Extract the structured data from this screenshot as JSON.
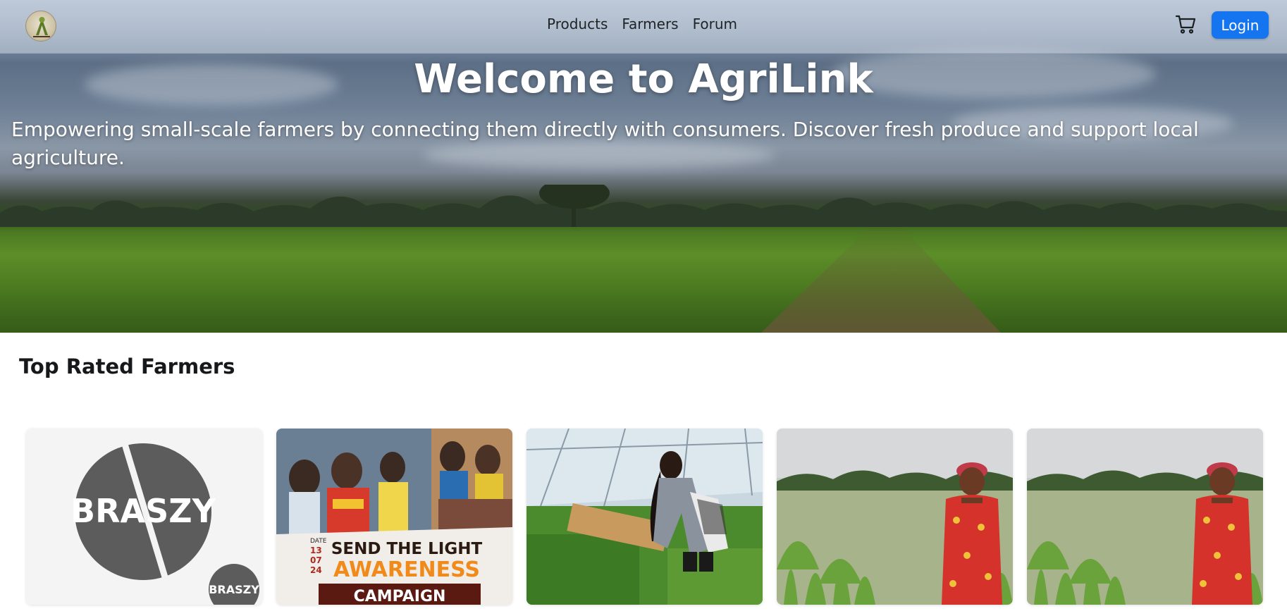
{
  "brand": {
    "logo_icon": "agrilink-logo-icon"
  },
  "nav": {
    "links": [
      {
        "label": "Products"
      },
      {
        "label": "Farmers"
      },
      {
        "label": "Forum"
      }
    ],
    "cart_icon": "shopping-cart-icon",
    "login_label": "Login",
    "accent_color": "#1575f0"
  },
  "hero": {
    "title": "Welcome to AgriLink",
    "subtitle": "Empowering small-scale farmers by connecting them directly with consumers. Discover fresh produce and support local agriculture."
  },
  "top_rated": {
    "title": "Top Rated Farmers",
    "cards": [
      {
        "image": "braszy-logo",
        "brand_text": "BRASZY",
        "badge_text": "BRASZY"
      },
      {
        "image": "awareness-campaign-flyer",
        "date_label": "DATE",
        "date_lines": [
          "13",
          "07",
          "24"
        ],
        "line1": "SEND THE LIGHT",
        "line2": "AWARENESS",
        "line3": "CAMPAIGN"
      },
      {
        "image": "farmer-in-greenhouse"
      },
      {
        "image": "farmer-in-maize-field"
      },
      {
        "image": "farmer-in-maize-field"
      }
    ]
  }
}
